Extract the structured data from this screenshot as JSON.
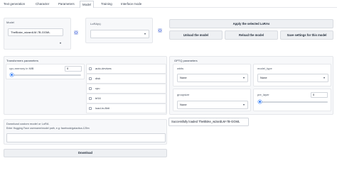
{
  "tabs": [
    {
      "label": "Text generation"
    },
    {
      "label": "Character"
    },
    {
      "label": "Parameters"
    },
    {
      "label": "Model"
    },
    {
      "label": "Training"
    },
    {
      "label": "Interface mode"
    }
  ],
  "model": {
    "label": "Model",
    "selected": "TheBloke_wizardLM-7B-GGML",
    "refresh_icon": "refresh-icon"
  },
  "lora": {
    "label": "LoRA(s)",
    "selected": "",
    "refresh_icon": "refresh-icon"
  },
  "buttons": {
    "apply_loras": "Apply the selected LoRAs",
    "unload": "Unload the model",
    "reload": "Reload the model",
    "save_settings": "Save settings for this model",
    "download": "Download"
  },
  "transformers": {
    "title": "Transformers parameters",
    "gpu_memory_label": "cpu-memory in MiB",
    "gpu_memory_value": "0",
    "checkboxes": [
      "auto-devices",
      "disk",
      "cpu",
      "bf16",
      "load-in-8bit"
    ]
  },
  "gptq": {
    "title": "GPTQ parameters",
    "wbits_label": "wbits",
    "wbits_value": "None",
    "model_type_label": "model_type",
    "model_type_value": "None",
    "groupsize_label": "groupsize",
    "groupsize_value": "None",
    "pre_layer_label": "pre_layer",
    "pre_layer_value": "0"
  },
  "download": {
    "title": "Download custom model or LoRA",
    "hint": "Enter Hugging Face username/model path, e.g: facebook/galactica-125m",
    "value": ""
  },
  "status": {
    "message": "Successfully loaded TheBloke_wizardLM-7B-GGML"
  },
  "colors": {
    "highlight": "#d0021b",
    "accent": "#3b82f6"
  }
}
